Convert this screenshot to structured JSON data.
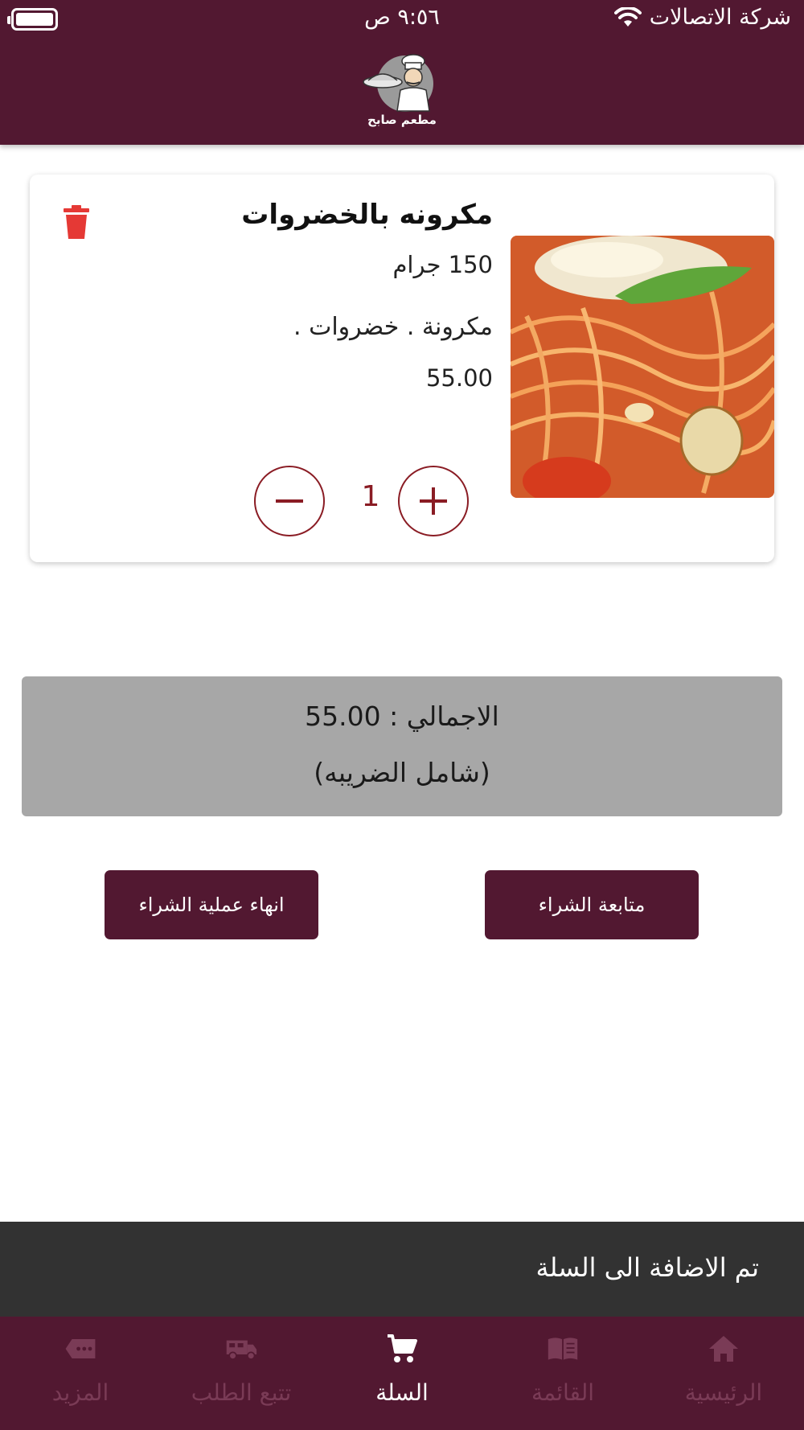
{
  "status_bar": {
    "carrier": "شركة الاتصالات",
    "time": "٩:٥٦ ص"
  },
  "header": {
    "logo_text": "مطعم صابح"
  },
  "cart_item": {
    "title": "مكرونه بالخضروات",
    "weight": "150 جرام",
    "description": "مكرونة . خضروات .",
    "price": "55.00",
    "quantity": "1"
  },
  "total": {
    "total_line": "الاجمالي : 55.00",
    "tax_note": "(شامل الضريبه)"
  },
  "actions": {
    "finish_label": "انهاء عملية الشراء",
    "continue_label": "متابعة الشراء"
  },
  "snackbar": {
    "message": "تم الاضافة الى السلة"
  },
  "bottom_nav": {
    "items": [
      {
        "label": "الرئيسية",
        "icon": "home-icon"
      },
      {
        "label": "القائمة",
        "icon": "menu-book-icon"
      },
      {
        "label": "السلة",
        "icon": "cart-icon",
        "active": true
      },
      {
        "label": "تتبع الطلب",
        "icon": "truck-icon"
      },
      {
        "label": "المزيد",
        "icon": "more-tag-icon"
      }
    ]
  },
  "colors": {
    "brand": "#521831",
    "accent_dark_red": "#8a1c24",
    "delete_red": "#e53935",
    "total_bg": "#a7a7a7",
    "snackbar_bg": "#323232",
    "inactive_nav": "#7a3b56"
  }
}
